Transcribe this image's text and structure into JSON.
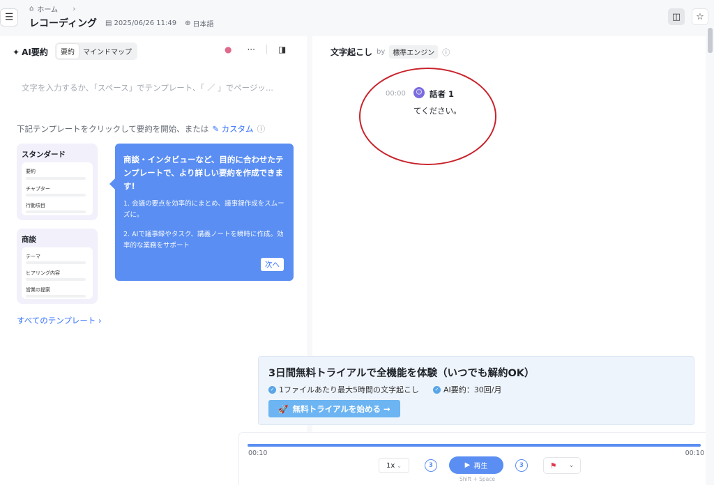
{
  "header": {
    "breadcrumb_home": "ホーム",
    "title": "レコーディング",
    "datetime": "2025/06/26 11:49",
    "language": "日本語"
  },
  "summary_panel": {
    "title": "AI要約",
    "tabs": [
      {
        "label": "要約",
        "active": true
      },
      {
        "label": "マインドマップ",
        "active": false
      }
    ],
    "input_placeholder": "文字を入力するか、「スペース」でテンプレート、「 ／ 」でページッ...",
    "template_hint": "下記テンプレートをクリックして要約を開始、または",
    "custom_label": "カスタム",
    "templates": [
      {
        "title": "スタンダード",
        "rows": [
          "要約",
          "チャプター",
          "行動項目"
        ]
      },
      {
        "title": "商談",
        "rows": [
          "テーマ",
          "ヒアリング内容",
          "営業の提案"
        ]
      }
    ],
    "all_templates": "すべてのテンプレート"
  },
  "tooltip": {
    "title": "商談・インタビューなど、目的に合わせたテンプレートで、より詳しい要約を作成できます!",
    "point1": "1. 会議の要点を効率的にまとめ、議事録作成をスムーズに。",
    "point2": "2. AIで議事録やタスク、講義ノートを瞬時に作成。効率的な業務をサポート",
    "next": "次へ"
  },
  "transcript": {
    "title": "文字起こし",
    "by": "by",
    "engine": "標準エンジン",
    "entries": [
      {
        "time": "00:00",
        "speaker": "話者 1",
        "text": "てください。"
      }
    ]
  },
  "trial": {
    "title": "3日間無料トライアルで全機能を体験（いつでも解約OK）",
    "feature1": "1ファイルあたり最大5時間の文字起こし",
    "feature2": "AI要約：30回/月",
    "button": "無料トライアルを始める →"
  },
  "player": {
    "current_time": "00:10",
    "total_time": "00:10",
    "progress": 1.0,
    "speed": "1x",
    "skip_back": "3",
    "skip_forward": "3",
    "play_label": "再生",
    "shortcut": "Shift + Space"
  },
  "colors": {
    "accent": "#5a8ef2",
    "link": "#3370ff",
    "annotation": "#c8232c"
  }
}
